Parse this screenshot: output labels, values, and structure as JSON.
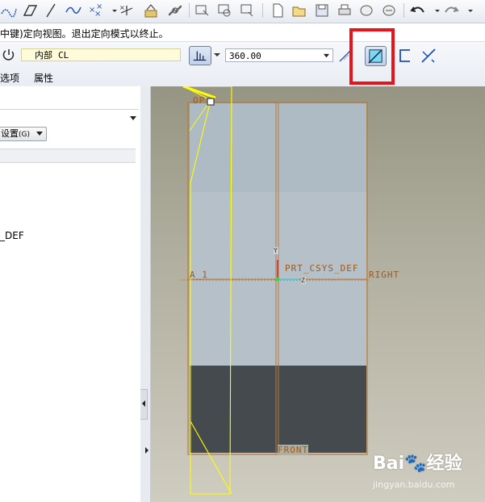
{
  "message": "中键)定向视图。退出定向模式以终止。",
  "dashboard": {
    "reference_prefix": "内部",
    "reference_value": "CL",
    "angle_value": "360.00",
    "tabs": [
      "选项",
      "属性"
    ]
  },
  "left_panel": {
    "settings_label": "设置",
    "settings_shortcut": "(G)",
    "tree_item_fragment": "_DEF"
  },
  "viewport": {
    "labels": {
      "top": "OP",
      "left_plane": "A_1",
      "csys": "PRT_CSYS_DEF",
      "right": "RIGHT",
      "front": "FRONT",
      "axis_y": "Y",
      "axis_z": "Z"
    }
  },
  "watermark": {
    "logo_text": "Bai",
    "logo_suffix": "经验",
    "url": "jingyan.baidu.com"
  },
  "colors": {
    "highlight": "#e8141b",
    "part_fill": "#b6c0c8",
    "part_dark": "#454a4e",
    "edge": "#b8793a",
    "yellow": "#ffff00"
  }
}
